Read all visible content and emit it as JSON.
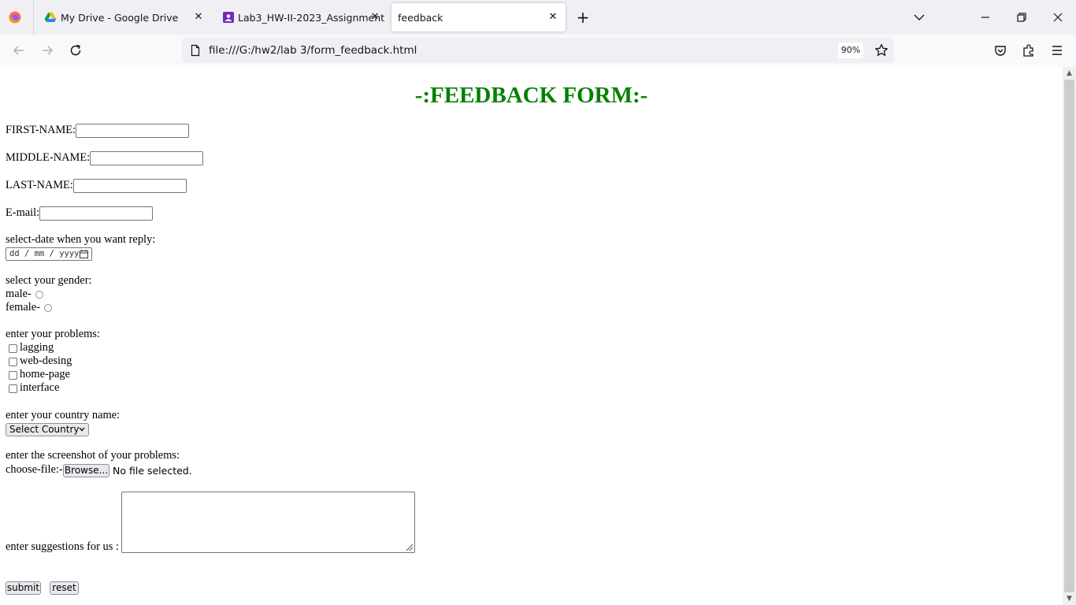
{
  "browser": {
    "tabs": [
      {
        "title": "My Drive - Google Drive",
        "active": false,
        "favicon": "google-drive-icon"
      },
      {
        "title": "Lab3_HW-II-2023_Assignment",
        "active": false,
        "favicon": "classroom-assignment-icon"
      },
      {
        "title": "feedback",
        "active": true,
        "favicon": ""
      }
    ],
    "url": "file:///G:/hw2/lab 3/form_feedback.html",
    "zoom": "90%"
  },
  "form": {
    "heading": "-:FEEDBACK FORM:-",
    "first_name_label": "FIRST-NAME:",
    "middle_name_label": "MIDDLE-NAME:",
    "last_name_label": "LAST-NAME:",
    "email_label": "E-mail:",
    "date_label": "select-date when you want reply:",
    "date_placeholder": "dd / mm / yyyy",
    "gender_label": "select your gender:",
    "gender_male": "male-",
    "gender_female": "female-",
    "problems_label": "enter your problems:",
    "problems": [
      "lagging",
      "web-desing",
      "home-page",
      "interface"
    ],
    "country_label": "enter your country name:",
    "country_selected": "Select Country",
    "screenshot_label": "enter the screenshot of your problems:",
    "choose_file_label": "choose-file:-",
    "browse_button": "Browse...",
    "no_file": "No file selected.",
    "suggestions_label": "enter suggestions for us :",
    "submit_button": "submit",
    "reset_button": "reset"
  }
}
